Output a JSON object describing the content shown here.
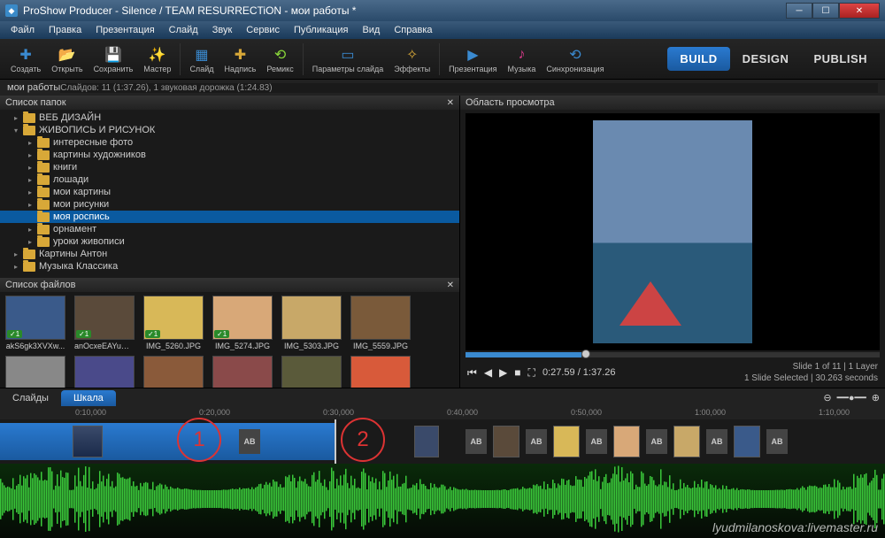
{
  "titlebar": {
    "title": "ProShow Producer - Silence / TEAM RESURRECTiON - мои работы *"
  },
  "menu": [
    "Файл",
    "Правка",
    "Презентация",
    "Слайд",
    "Звук",
    "Сервис",
    "Публикация",
    "Вид",
    "Справка"
  ],
  "toolbar": [
    {
      "icon": "✚",
      "label": "Создать",
      "color": "#3a8ad0"
    },
    {
      "icon": "📂",
      "label": "Открыть",
      "color": "#d8a838"
    },
    {
      "icon": "💾",
      "label": "Сохранить",
      "color": "#3a8ad0"
    },
    {
      "icon": "✨",
      "label": "Мастер",
      "color": "#d8a838"
    },
    {
      "sep": true
    },
    {
      "icon": "▦",
      "label": "Слайд",
      "color": "#3a8ad0"
    },
    {
      "icon": "✚",
      "label": "Надпись",
      "color": "#d8a838"
    },
    {
      "icon": "⟲",
      "label": "Ремикс",
      "color": "#8ad83a"
    },
    {
      "sep": true
    },
    {
      "icon": "▭",
      "label": "Параметры слайда",
      "color": "#3a8ad0"
    },
    {
      "icon": "✧",
      "label": "Эффекты",
      "color": "#d8a838"
    },
    {
      "sep": true
    },
    {
      "icon": "▶",
      "label": "Презентация",
      "color": "#3a8ad0"
    },
    {
      "icon": "♪",
      "label": "Музыка",
      "color": "#d83a8a"
    },
    {
      "icon": "⟲",
      "label": "Синхронизация",
      "color": "#3a8ad0"
    }
  ],
  "modes": {
    "build": "BUILD",
    "design": "DESIGN",
    "publish": "PUBLISH"
  },
  "project": {
    "name": "мои работы",
    "status": "Слайдов: 11 (1:37.26), 1 звуковая дорожка (1:24.83)"
  },
  "panels": {
    "folders": "Список папок",
    "files": "Список файлов",
    "preview": "Область просмотра"
  },
  "tree": [
    {
      "ind": 1,
      "label": "ВЕБ ДИЗАЙН",
      "exp": false
    },
    {
      "ind": 1,
      "label": "ЖИВОПИСЬ И РИСУНОК",
      "exp": true
    },
    {
      "ind": 2,
      "label": "интересные фото",
      "exp": false
    },
    {
      "ind": 2,
      "label": "картины художников",
      "exp": false
    },
    {
      "ind": 2,
      "label": "книги",
      "exp": false
    },
    {
      "ind": 2,
      "label": "лошади",
      "exp": false
    },
    {
      "ind": 2,
      "label": "мои картины",
      "exp": false
    },
    {
      "ind": 2,
      "label": "мои рисунки",
      "exp": false
    },
    {
      "ind": 2,
      "label": "моя роспись",
      "sel": true
    },
    {
      "ind": 2,
      "label": "орнамент",
      "exp": false
    },
    {
      "ind": 2,
      "label": "уроки живописи",
      "exp": false
    },
    {
      "ind": 1,
      "label": "Картины Антон",
      "exp": false
    },
    {
      "ind": 1,
      "label": "Музыка Классика",
      "exp": false
    }
  ],
  "files": [
    {
      "name": "akS6gk3XVXw...",
      "c": "#3a5a8a",
      "badge": "✓1"
    },
    {
      "name": "anOcxeEAYuU.j...",
      "c": "#5a4a3a",
      "badge": "✓1"
    },
    {
      "name": "IMG_5260.JPG",
      "c": "#d8b858",
      "badge": "✓1"
    },
    {
      "name": "IMG_5274.JPG",
      "c": "#d8a878",
      "badge": "✓1"
    },
    {
      "name": "IMG_5303.JPG",
      "c": "#c8a868"
    },
    {
      "name": "IMG_5559.JPG",
      "c": "#7a5a3a"
    },
    {
      "name": "",
      "c": "#888888"
    },
    {
      "name": "",
      "c": "#4a4a8a"
    },
    {
      "name": "",
      "c": "#8a5a3a"
    },
    {
      "name": "",
      "c": "#8a4a4a"
    },
    {
      "name": "",
      "c": "#5a5a3a"
    },
    {
      "name": "",
      "c": "#d85a3a"
    },
    {
      "name": "",
      "c": "#5a3a8a"
    }
  ],
  "playback": {
    "time": "0:27.59 / 1:37.26",
    "info1": "Slide 1 of 11  |  1 Layer",
    "info2": "1 Slide Selected  |  30.263 seconds"
  },
  "tabs": {
    "slides": "Слайды",
    "scale": "Шкала"
  },
  "ruler": [
    "0:10,000",
    "0:20,000",
    "0:30,000",
    "0:40,000",
    "0:50,000",
    "1:00,000",
    "1:10,000"
  ],
  "annot": {
    "one": "1",
    "two": "2"
  },
  "watermark": "lyudmilanoskova:livemaster.ru"
}
